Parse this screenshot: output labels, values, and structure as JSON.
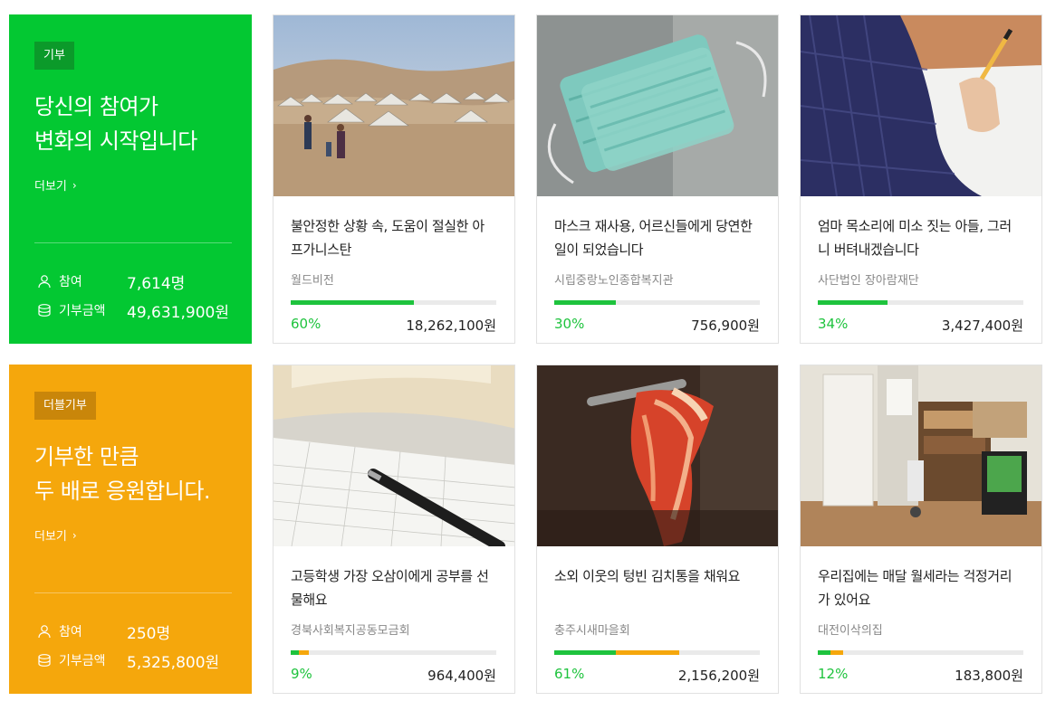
{
  "donate": {
    "tag": "기부",
    "headline": "당신의 참여가\n변화의 시작입니다",
    "more": "더보기",
    "participants_label": "참여",
    "participants": "7,614명",
    "amount_label": "기부금액",
    "amount": "49,631,900원",
    "color": "#03c832"
  },
  "double_donate": {
    "tag": "더블기부",
    "headline": "기부한 만큼\n두 배로 응원합니다.",
    "more": "더보기",
    "participants_label": "참여",
    "participants": "250명",
    "amount_label": "기부금액",
    "amount": "5,325,800원",
    "color": "#f5a70c"
  },
  "cards": [
    {
      "title": "불안정한 상황 속, 도움이 절실한 아프가니스탄",
      "org": "월드비전",
      "percent": "60%",
      "amount": "18,262,100원",
      "progress": 0.6,
      "double_progress": 0,
      "image": "refugee-camp"
    },
    {
      "title": "마스크 재사용, 어르신들에게 당연한 일이 되었습니다",
      "org": "시립중랑노인종합복지관",
      "percent": "30%",
      "amount": "756,900원",
      "progress": 0.3,
      "double_progress": 0,
      "image": "face-masks"
    },
    {
      "title": "엄마 목소리에 미소 짓는 아들, 그러니 버텨내겠습니다",
      "org": "사단법인 장아람재단",
      "percent": "34%",
      "amount": "3,427,400원",
      "progress": 0.34,
      "double_progress": 0,
      "image": "writing-hand"
    },
    {
      "title": "고등학생 가장 오삼이에게 공부를 선물해요",
      "org": "경북사회복지공동모금회",
      "percent": "9%",
      "amount": "964,400원",
      "progress": 0.04,
      "double_progress": 0.05,
      "image": "book-and-pen"
    },
    {
      "title": "소외 이웃의 텅빈 김치통을 채워요",
      "org": "충주시새마을회",
      "percent": "61%",
      "amount": "2,156,200원",
      "progress": 0.3,
      "double_progress": 0.31,
      "image": "kimchi"
    },
    {
      "title": "우리집에는 매달 월세라는 걱정거리가 있어요",
      "org": "대전이삭의집",
      "percent": "12%",
      "amount": "183,800원",
      "progress": 0.06,
      "double_progress": 0.06,
      "image": "room-desk"
    }
  ]
}
